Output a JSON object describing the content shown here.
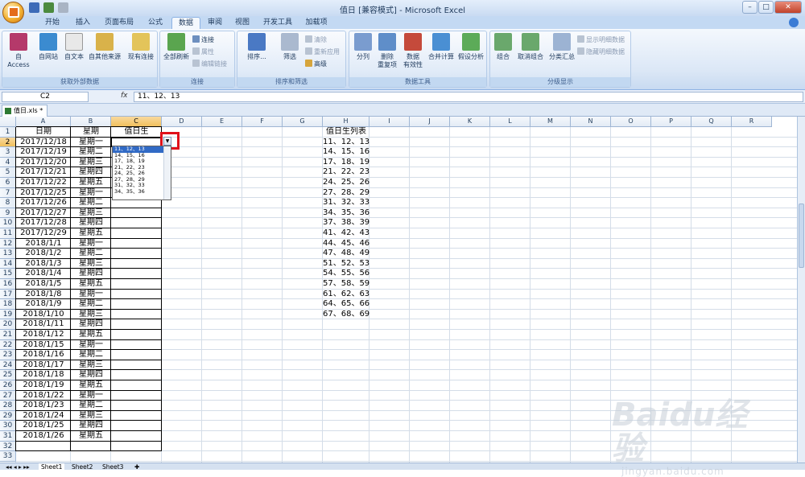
{
  "window": {
    "title": "值日  [兼容模式] - Microsoft Excel",
    "minimize": "–",
    "restore": "□",
    "close": "✕"
  },
  "ribbon_tabs": [
    "开始",
    "插入",
    "页面布局",
    "公式",
    "数据",
    "审阅",
    "视图",
    "开发工具",
    "加载项"
  ],
  "active_tab": "数据",
  "ribbon": {
    "groups": [
      {
        "label": "获取外部数据",
        "buttons": [
          "自 Access",
          "自网站",
          "自文本",
          "自其他来源",
          "现有连接"
        ]
      },
      {
        "label": "连接",
        "big": "全部刷新",
        "small": [
          "连接",
          "属性",
          "编辑链接"
        ]
      },
      {
        "label": "排序和筛选",
        "big": [
          "排序...",
          "筛选"
        ],
        "small": [
          "清除",
          "重新应用",
          "高级"
        ]
      },
      {
        "label": "数据工具",
        "buttons": [
          "分列",
          "删除\n重复项",
          "数据\n有效性",
          "合并计算",
          "假设分析"
        ]
      },
      {
        "label": "分级显示",
        "buttons": [
          "组合",
          "取消组合",
          "分类汇总"
        ],
        "small": [
          "显示明细数据",
          "隐藏明细数据"
        ]
      }
    ]
  },
  "formula_bar": {
    "name_box": "C2",
    "fx": "fx",
    "value": "11、12、13"
  },
  "document_tab": "值日.xls *",
  "columns": [
    "A",
    "B",
    "C",
    "D",
    "E",
    "F",
    "G",
    "H",
    "I",
    "J",
    "K",
    "L",
    "M",
    "N",
    "O",
    "P",
    "Q",
    "R"
  ],
  "headers": {
    "a": "日期",
    "b": "星期",
    "c": "值日生",
    "h": "值日生列表"
  },
  "rows": [
    [
      "2017/12/18",
      "星期一"
    ],
    [
      "2017/12/19",
      "星期二"
    ],
    [
      "2017/12/20",
      "星期三"
    ],
    [
      "2017/12/21",
      "星期四"
    ],
    [
      "2017/12/22",
      "星期五"
    ],
    [
      "2017/12/25",
      "星期一"
    ],
    [
      "2017/12/26",
      "星期二"
    ],
    [
      "2017/12/27",
      "星期三"
    ],
    [
      "2017/12/28",
      "星期四"
    ],
    [
      "2017/12/29",
      "星期五"
    ],
    [
      "2018/1/1",
      "星期一"
    ],
    [
      "2018/1/2",
      "星期二"
    ],
    [
      "2018/1/3",
      "星期三"
    ],
    [
      "2018/1/4",
      "星期四"
    ],
    [
      "2018/1/5",
      "星期五"
    ],
    [
      "2018/1/8",
      "星期一"
    ],
    [
      "2018/1/9",
      "星期二"
    ],
    [
      "2018/1/10",
      "星期三"
    ],
    [
      "2018/1/11",
      "星期四"
    ],
    [
      "2018/1/12",
      "星期五"
    ],
    [
      "2018/1/15",
      "星期一"
    ],
    [
      "2018/1/16",
      "星期二"
    ],
    [
      "2018/1/17",
      "星期三"
    ],
    [
      "2018/1/18",
      "星期四"
    ],
    [
      "2018/1/19",
      "星期五"
    ],
    [
      "2018/1/22",
      "星期一"
    ],
    [
      "2018/1/23",
      "星期二"
    ],
    [
      "2018/1/24",
      "星期三"
    ],
    [
      "2018/1/25",
      "星期四"
    ],
    [
      "2018/1/26",
      "星期五"
    ]
  ],
  "duty_list": [
    "11、12、13",
    "14、15、16",
    "17、18、19",
    "21、22、23",
    "24、25、26",
    "27、28、29",
    "31、32、33",
    "34、35、36",
    "37、38、39",
    "41、42、43",
    "44、45、46",
    "47、48、49",
    "51、52、53",
    "54、55、56",
    "57、58、59",
    "61、62、63",
    "64、65、66",
    "67、68、69"
  ],
  "dropdown_visible": [
    "11、12、13",
    "14、15、16",
    "17、18、19",
    "21、22、23",
    "24、25、26",
    "27、28、29",
    "31、32、33",
    "34、35、36"
  ],
  "sheet_tabs": [
    "Sheet1",
    "Sheet2",
    "Sheet3"
  ],
  "watermark": {
    "logo": "Baidu经验",
    "url": "jingyan.baidu.com"
  }
}
